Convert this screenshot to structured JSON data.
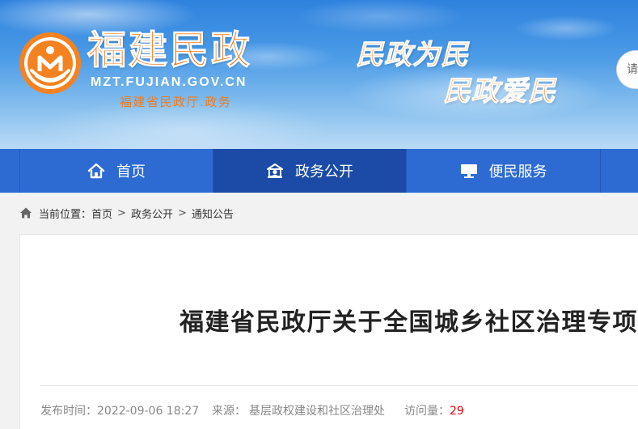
{
  "header": {
    "logo_icon": "civil-affairs-emblem-icon",
    "logo_title": "福建民政",
    "logo_domain": "MZT.FUJIAN.GOV.CN",
    "logo_subtitle": "福建省民政厅.政务",
    "slogan_1": "民政为民",
    "slogan_2": "民政爱民",
    "search": {
      "placeholder": "请"
    }
  },
  "nav": {
    "items": [
      {
        "label": "首页",
        "icon": "home-icon",
        "active": false
      },
      {
        "label": "政务公开",
        "icon": "gov-affairs-icon",
        "active": true
      },
      {
        "label": "便民服务",
        "icon": "monitor-icon",
        "active": false
      }
    ]
  },
  "breadcrumb": {
    "icon": "home-icon",
    "prefix": "当前位置：",
    "separator": ">",
    "items": [
      "首页",
      "政务公开",
      "通知公告"
    ]
  },
  "article": {
    "title": "福建省民政厅关于全国城乡社区治理专项",
    "meta": {
      "publish_label": "发布时间：",
      "publish_time": "2022-09-06 18:27",
      "source_label": "来源：",
      "source": "基层政权建设和社区治理处",
      "views_label": "访问量：",
      "views": "29"
    }
  },
  "colors": {
    "brand_orange": "#f07a1c",
    "nav_bg": "#2d6bd3",
    "nav_active": "#1b4ba6",
    "views_red": "#e60012"
  }
}
